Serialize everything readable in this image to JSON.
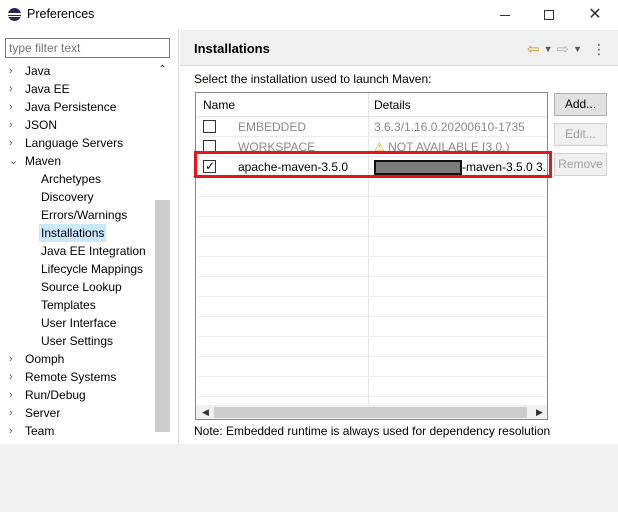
{
  "window": {
    "title": "Preferences"
  },
  "filter": {
    "placeholder": "type filter text"
  },
  "tree": [
    {
      "label": "Java",
      "arrow": "›",
      "child": false
    },
    {
      "label": "Java EE",
      "arrow": "›",
      "child": false
    },
    {
      "label": "Java Persistence",
      "arrow": "›",
      "child": false
    },
    {
      "label": "JSON",
      "arrow": "›",
      "child": false
    },
    {
      "label": "Language Servers",
      "arrow": "›",
      "child": false
    },
    {
      "label": "Maven",
      "arrow": "⌄",
      "child": false
    },
    {
      "label": "Archetypes",
      "child": true
    },
    {
      "label": "Discovery",
      "child": true
    },
    {
      "label": "Errors/Warnings",
      "child": true
    },
    {
      "label": "Installations",
      "child": true,
      "selected": true
    },
    {
      "label": "Java EE Integration",
      "child": true
    },
    {
      "label": "Lifecycle Mappings",
      "child": true
    },
    {
      "label": "Source Lookup",
      "child": true
    },
    {
      "label": "Templates",
      "child": true
    },
    {
      "label": "User Interface",
      "child": true
    },
    {
      "label": "User Settings",
      "child": true
    },
    {
      "label": "Oomph",
      "arrow": "›",
      "child": false
    },
    {
      "label": "Remote Systems",
      "arrow": "›",
      "child": false
    },
    {
      "label": "Run/Debug",
      "arrow": "›",
      "child": false
    },
    {
      "label": "Server",
      "arrow": "›",
      "child": false
    },
    {
      "label": "Team",
      "arrow": "›",
      "child": false
    }
  ],
  "page": {
    "title": "Installations",
    "description": "Select the installation used to launch Maven:",
    "note": "Note: Embedded runtime is always used for dependency resolution"
  },
  "table": {
    "columns": [
      "Name",
      "Details"
    ],
    "rows": [
      {
        "name": "EMBEDDED",
        "details": "3.6.3/1.16.0.20200610-1735",
        "checked": false,
        "disabled": true
      },
      {
        "name": "WORKSPACE",
        "details": "NOT AVAILABLE [3.0,)",
        "checked": false,
        "disabled": true,
        "warning": true
      },
      {
        "name": "apache-maven-3.5.0",
        "details": "-maven-3.5.0 3.",
        "checked": true,
        "disabled": false,
        "redacted_prefix": true
      }
    ]
  },
  "buttons": {
    "add": "Add...",
    "edit": "Edit...",
    "remove": "Remove"
  },
  "colors": {
    "highlight": "#e8141c",
    "selection": "#cce8ff",
    "warning": "#e5a31a"
  }
}
